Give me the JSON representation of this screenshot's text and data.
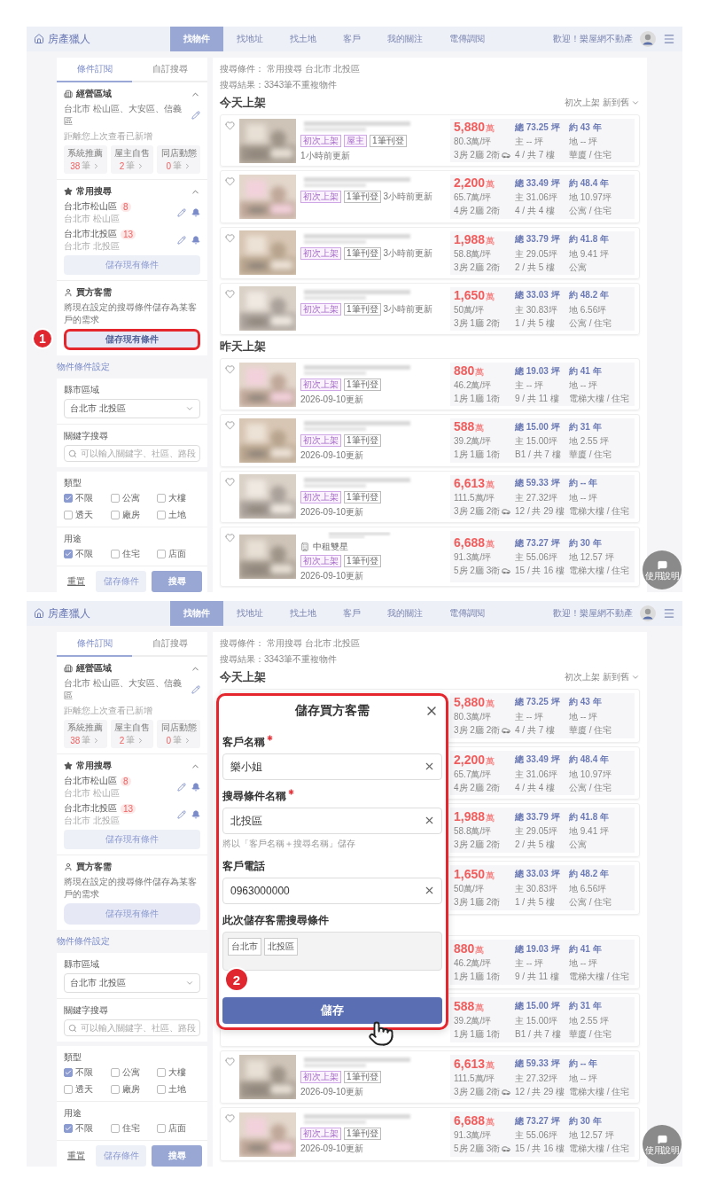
{
  "screens": [
    {
      "header": {
        "logo": "房產獵人",
        "nav": [
          {
            "label": "找物件",
            "selected": true
          },
          {
            "label": "找地址",
            "selected": false
          },
          {
            "label": "找土地",
            "selected": false
          },
          {
            "label": "客戶",
            "selected": false
          },
          {
            "label": "我的關注",
            "selected": false
          },
          {
            "label": "電傳調閱",
            "selected": false
          }
        ],
        "welcome": "歡迎！樂屋網不動產"
      },
      "sidebar": {
        "tabs": [
          {
            "label": "條件訂閱",
            "selected": true
          },
          {
            "label": "自訂搜尋",
            "selected": false
          }
        ],
        "area": {
          "title": "經營區域",
          "expanded": true,
          "value": "台北市 松山區、大安區、信義區",
          "note": "距離您上次查看已新增",
          "stats": [
            {
              "label": "系統推薦",
              "count": "38",
              "unit": "筆"
            },
            {
              "label": "屋主自售",
              "count": "2",
              "unit": "筆"
            },
            {
              "label": "同店動態",
              "count": "0",
              "unit": "筆"
            }
          ]
        },
        "saved": {
          "title": "常用搜尋",
          "expanded": true,
          "items": [
            {
              "name": "台北市松山區",
              "badge": "8",
              "sub": "台北市 松山區"
            },
            {
              "name": "台北市北投區",
              "badge": "13",
              "sub": "台北市 北投區"
            }
          ],
          "button": "儲存現有條件"
        },
        "buyer": {
          "title": "買方客需",
          "description": "將現在設定的搜尋條件儲存為某客戶的需求",
          "button": "儲存現有條件",
          "highlighted": true,
          "annotation": "1"
        },
        "filters_title": "物件條件設定",
        "region": {
          "label": "縣市區域",
          "value": "台北市 北投區"
        },
        "keyword": {
          "label": "關鍵字搜尋",
          "placeholder": "可以輸入關鍵字、社區、路段"
        },
        "groups": [
          {
            "title": "類型",
            "options": [
              {
                "label": "不限",
                "checked": true
              },
              {
                "label": "公寓",
                "checked": false
              },
              {
                "label": "大樓",
                "checked": false
              },
              {
                "label": "透天",
                "checked": false
              },
              {
                "label": "廠房",
                "checked": false
              },
              {
                "label": "土地",
                "checked": false
              }
            ]
          },
          {
            "title": "用途",
            "options": [
              {
                "label": "不限",
                "checked": true
              },
              {
                "label": "住宅",
                "checked": false
              },
              {
                "label": "店面",
                "checked": false
              }
            ]
          }
        ],
        "footer": {
          "reset": "重置",
          "save": "儲存條件",
          "search": "搜尋"
        }
      },
      "results": {
        "criteria": "搜尋條件： 常用搜尋 台北市 北投區",
        "total": "搜尋結果：3343筆不重複物件",
        "sort": "初次上架 新到舊",
        "sections": [
          {
            "heading": "今天上架",
            "listings": [
              {
                "kind": "full",
                "tags": [
                  {
                    "label": "初次上架",
                    "kind": "highlight"
                  },
                  {
                    "label": "屋主",
                    "kind": "highlight"
                  },
                  {
                    "label": "1筆刊登",
                    "kind": "plain"
                  }
                ],
                "updated": "1小時前更新",
                "price": "5,880",
                "price_unit": "萬",
                "unit_price": "80.3萬/坪",
                "layout": "3房 2廳 2衛",
                "parking": true,
                "area": "總 73.25 坪",
                "main_area": "主 -- 坪",
                "floor": "4 / 共 7 樓",
                "age": "約 43 年",
                "land": "地 -- 坪",
                "type": "華廈 / 住宅"
              },
              {
                "kind": "full",
                "tags": [
                  {
                    "label": "初次上架",
                    "kind": "highlight"
                  },
                  {
                    "label": "1筆刊登",
                    "kind": "plain"
                  }
                ],
                "updated": "3小時前更新",
                "price": "2,200",
                "price_unit": "萬",
                "unit_price": "65.7萬/坪",
                "layout": "4房 2廳 2衛",
                "parking": false,
                "area": "總 33.49 坪",
                "main_area": "主 31.06坪",
                "floor": "4 / 共 4 樓",
                "age": "約 48.4 年",
                "land": "地 10.97坪",
                "type": "公寓 / 住宅"
              },
              {
                "kind": "full",
                "tags": [
                  {
                    "label": "初次上架",
                    "kind": "highlight"
                  },
                  {
                    "label": "1筆刊登",
                    "kind": "plain"
                  }
                ],
                "updated": "3小時前更新",
                "price": "1,988",
                "price_unit": "萬",
                "unit_price": "58.8萬/坪",
                "layout": "3房 2廳 2衛",
                "parking": false,
                "area": "總 33.79 坪",
                "main_area": "主 29.05坪",
                "floor": "2 / 共 5 樓",
                "age": "約 41.8 年",
                "land": "地 9.41 坪",
                "type": "公寓"
              },
              {
                "kind": "full",
                "tags": [
                  {
                    "label": "初次上架",
                    "kind": "highlight"
                  },
                  {
                    "label": "1筆刊登",
                    "kind": "plain"
                  }
                ],
                "updated": "3小時前更新",
                "price": "1,650",
                "price_unit": "萬",
                "unit_price": "50萬/坪",
                "layout": "3房 1廳 2衛",
                "parking": false,
                "area": "總 33.03 坪",
                "main_area": "主 30.83坪",
                "floor": "1 / 共 5 樓",
                "age": "約 48.2 年",
                "land": "地 6.56坪",
                "type": "公寓 / 住宅"
              }
            ]
          },
          {
            "heading": "昨天上架",
            "listings": [
              {
                "kind": "full",
                "tags": [
                  {
                    "label": "初次上架",
                    "kind": "highlight"
                  },
                  {
                    "label": "1筆刊登",
                    "kind": "plain"
                  }
                ],
                "updated": "2026-09-10更新",
                "price": "880",
                "price_unit": "萬",
                "unit_price": "46.2萬/坪",
                "layout": "1房 1廳 1衛",
                "parking": false,
                "area": "總 19.03 坪",
                "main_area": "主 -- 坪",
                "floor": "9 / 共 11 樓",
                "age": "約 41 年",
                "land": "地 -- 坪",
                "type": "電梯大樓 / 住宅"
              },
              {
                "kind": "full",
                "tags": [
                  {
                    "label": "初次上架",
                    "kind": "highlight"
                  },
                  {
                    "label": "1筆刊登",
                    "kind": "plain"
                  }
                ],
                "updated": "2026-09-10更新",
                "price": "588",
                "price_unit": "萬",
                "unit_price": "39.2萬/坪",
                "layout": "1房 1廳 1衛",
                "parking": false,
                "area": "總 15.00 坪",
                "main_area": "主 15.00坪",
                "floor": "B1 / 共 7 樓",
                "age": "約 31 年",
                "land": "地 2.55 坪",
                "type": "華廈 / 住宅"
              },
              {
                "kind": "full",
                "tags": [
                  {
                    "label": "初次上架",
                    "kind": "highlight"
                  },
                  {
                    "label": "1筆刊登",
                    "kind": "plain"
                  }
                ],
                "updated": "2026-09-10更新",
                "price": "6,613",
                "price_unit": "萬",
                "unit_price": "111.5萬/坪",
                "layout": "3房 2廳 2衛",
                "parking": true,
                "area": "總 59.33 坪",
                "main_area": "主 27.32坪",
                "floor": "12 / 共 29 樓",
                "age": "約 -- 年",
                "land": "地 -- 坪",
                "type": "電梯大樓 / 住宅"
              },
              {
                "kind": "full",
                "community": "中租雙星",
                "tags": [
                  {
                    "label": "初次上架",
                    "kind": "highlight"
                  },
                  {
                    "label": "1筆刊登",
                    "kind": "plain"
                  }
                ],
                "updated": "2026-09-10更新",
                "price": "6,688",
                "price_unit": "萬",
                "unit_price": "91.3萬/坪",
                "layout": "5房 2廳 3衛",
                "parking": true,
                "area": "總 73.27 坪",
                "main_area": "主 55.06坪",
                "floor": "15 / 共 16 樓",
                "age": "約 30 年",
                "land": "地 12.57 坪",
                "type": "電梯大樓 / 住宅"
              }
            ]
          }
        ]
      },
      "help_button": "使用說明"
    },
    {
      "header": {
        "logo": "房產獵人",
        "nav": [
          {
            "label": "找物件",
            "selected": true
          },
          {
            "label": "找地址",
            "selected": false
          },
          {
            "label": "找土地",
            "selected": false
          },
          {
            "label": "客戶",
            "selected": false
          },
          {
            "label": "我的關注",
            "selected": false
          },
          {
            "label": "電傳調閱",
            "selected": false
          }
        ],
        "welcome": "歡迎！樂屋網不動產"
      },
      "sidebar": {
        "tabs": [
          {
            "label": "條件訂閱",
            "selected": true
          },
          {
            "label": "自訂搜尋",
            "selected": false
          }
        ],
        "area": {
          "title": "經營區域",
          "expanded": true,
          "value": "台北市 松山區、大安區、信義區",
          "note": "距離您上次查看已新增",
          "stats": [
            {
              "label": "系統推薦",
              "count": "38",
              "unit": "筆"
            },
            {
              "label": "屋主自售",
              "count": "2",
              "unit": "筆"
            },
            {
              "label": "同店動態",
              "count": "0",
              "unit": "筆"
            }
          ]
        },
        "saved": {
          "title": "常用搜尋",
          "expanded": true,
          "items": [
            {
              "name": "台北市松山區",
              "badge": "8",
              "sub": "台北市 松山區"
            },
            {
              "name": "台北市北投區",
              "badge": "13",
              "sub": "台北市 北投區"
            }
          ],
          "button": "儲存現有條件"
        },
        "buyer": {
          "title": "買方客需",
          "description": "將現在設定的搜尋條件儲存為某客戶的需求",
          "button": "儲存現有條件",
          "highlighted": false
        },
        "filters_title": "物件條件設定",
        "region": {
          "label": "縣市區域",
          "value": "台北市 北投區"
        },
        "keyword": {
          "label": "關鍵字搜尋",
          "placeholder": "可以輸入關鍵字、社區、路段"
        },
        "groups": [
          {
            "title": "類型",
            "options": [
              {
                "label": "不限",
                "checked": true
              },
              {
                "label": "公寓",
                "checked": false
              },
              {
                "label": "大樓",
                "checked": false
              },
              {
                "label": "透天",
                "checked": false
              },
              {
                "label": "廠房",
                "checked": false
              },
              {
                "label": "土地",
                "checked": false
              }
            ]
          },
          {
            "title": "用途",
            "options": [
              {
                "label": "不限",
                "checked": true
              },
              {
                "label": "住宅",
                "checked": false
              },
              {
                "label": "店面",
                "checked": false
              }
            ]
          }
        ],
        "footer": {
          "reset": "重置",
          "save": "儲存條件",
          "search": "搜尋"
        }
      },
      "results": {
        "criteria": "搜尋條件： 常用搜尋 台北市 北投區",
        "total": "搜尋結果：3343筆不重複物件",
        "sort": "初次上架 新到舊",
        "sections": [
          {
            "heading": "今天上架",
            "listings": [
              {
                "kind": "covered",
                "price": "5,880",
                "price_unit": "萬",
                "unit_price": "80.3萬/坪",
                "layout": "3房 2廳 2衛",
                "parking": true,
                "area": "總 73.25 坪",
                "main_area": "主 -- 坪",
                "floor": "4 / 共 7 樓",
                "age": "約 43 年",
                "land": "地 -- 坪",
                "type": "華廈 / 住宅"
              },
              {
                "kind": "covered",
                "price": "2,200",
                "price_unit": "萬",
                "unit_price": "65.7萬/坪",
                "layout": "4房 2廳 2衛",
                "parking": false,
                "area": "總 33.49 坪",
                "main_area": "主 31.06坪",
                "floor": "4 / 共 4 樓",
                "age": "約 48.4 年",
                "land": "地 10.97坪",
                "type": "公寓 / 住宅"
              },
              {
                "kind": "covered",
                "price": "1,988",
                "price_unit": "萬",
                "unit_price": "58.8萬/坪",
                "layout": "3房 2廳 2衛",
                "parking": false,
                "area": "總 33.79 坪",
                "main_area": "主 29.05坪",
                "floor": "2 / 共 5 樓",
                "age": "約 41.8 年",
                "land": "地 9.41 坪",
                "type": "公寓"
              },
              {
                "kind": "covered",
                "price": "1,650",
                "price_unit": "萬",
                "unit_price": "50萬/坪",
                "layout": "3房 1廳 2衛",
                "parking": false,
                "area": "總 33.03 坪",
                "main_area": "主 30.83坪",
                "floor": "1 / 共 5 樓",
                "age": "約 48.2 年",
                "land": "地 6.56坪",
                "type": "公寓 / 住宅"
              }
            ]
          },
          {
            "listings": [
              {
                "kind": "covered",
                "price": "880",
                "price_unit": "萬",
                "unit_price": "46.2萬/坪",
                "layout": "1房 1廳 1衛",
                "parking": false,
                "area": "總 19.03 坪",
                "main_area": "主 -- 坪",
                "floor": "9 / 共 11 樓",
                "age": "約 41 年",
                "land": "地 -- 坪",
                "type": "電梯大樓 / 住宅"
              },
              {
                "kind": "covered",
                "price": "588",
                "price_unit": "萬",
                "unit_price": "39.2萬/坪",
                "layout": "1房 1廳 1衛",
                "parking": false,
                "area": "總 15.00 坪",
                "main_area": "主 15.00坪",
                "floor": "B1 / 共 7 樓",
                "age": "約 31 年",
                "land": "地 2.55 坪",
                "type": "華廈 / 住宅"
              },
              {
                "kind": "full",
                "tags": [
                  {
                    "label": "初次上架",
                    "kind": "highlight"
                  },
                  {
                    "label": "1筆刊登",
                    "kind": "plain"
                  }
                ],
                "updated": "2026-09-10更新",
                "price": "6,613",
                "price_unit": "萬",
                "unit_price": "111.5萬/坪",
                "layout": "3房 2廳 2衛",
                "parking": true,
                "area": "總 59.33 坪",
                "main_area": "主 27.32坪",
                "floor": "12 / 共 29 樓",
                "age": "約 -- 年",
                "land": "地 -- 坪",
                "type": "電梯大樓 / 住宅"
              },
              {
                "kind": "full",
                "tags": [
                  {
                    "label": "初次上架",
                    "kind": "highlight"
                  },
                  {
                    "label": "1筆刊登",
                    "kind": "plain"
                  }
                ],
                "updated": "2026-09-10更新",
                "price": "6,688",
                "price_unit": "萬",
                "unit_price": "91.3萬/坪",
                "layout": "5房 2廳 3衛",
                "parking": true,
                "area": "總 73.27 坪",
                "main_area": "主 55.06坪",
                "floor": "15 / 共 16 樓",
                "age": "約 30 年",
                "land": "地 12.57 坪",
                "type": "電梯大樓 / 住宅"
              }
            ]
          }
        ]
      },
      "dialog": {
        "title": "儲存買方客需",
        "highlighted": true,
        "fields": [
          {
            "label": "客戶名稱",
            "required": true,
            "value": "樂小姐"
          },
          {
            "label": "搜尋條件名稱",
            "required": true,
            "value": "北投區",
            "hint": "將以「客戶名稱＋搜尋名稱」儲存"
          },
          {
            "label": "客戶電話",
            "required": false,
            "value": "0963000000"
          }
        ],
        "conditions_label": "此次儲存客需搜尋條件",
        "conditions": [
          "台北市",
          "北投區"
        ],
        "button": "儲存",
        "annotation": "2"
      },
      "help_button": "使用說明"
    }
  ]
}
